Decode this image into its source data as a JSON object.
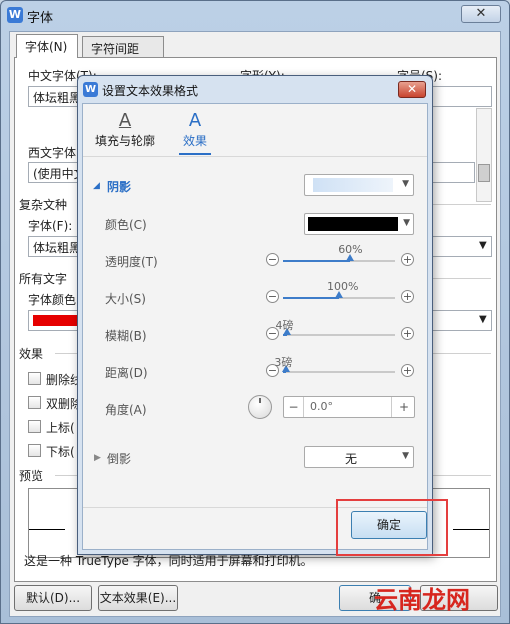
{
  "window": {
    "title": "字体",
    "app_icon_glyph": "W",
    "close_glyph": "✕"
  },
  "tabs": [
    {
      "label": "字体(N)",
      "active": true
    },
    {
      "label": "字符间距(R)",
      "active": false
    }
  ],
  "font_section": {
    "chinese_font_label": "中文字体(T):",
    "chinese_font_value": "体坛粗黑",
    "style_label": "字形(Y):",
    "size_label": "字号(S):",
    "western_font_label": "西文字体(",
    "western_font_value": "(使用中文",
    "complex_group_label": "复杂文种",
    "complex_font_label": "字体(F):",
    "complex_font_value": "体坛粗黑",
    "all_text_group_label": "所有文字",
    "font_color_label": "字体颜色(",
    "font_color_value": "#e60000",
    "effects_group_label": "效果",
    "effects": [
      "删除线",
      "双删除",
      "上标(",
      "下标("
    ],
    "preview_group_label": "预览",
    "truetype_note": "这是一种 TrueType 字体，同时适用于屏幕和打印机。"
  },
  "footer_buttons": {
    "default": "默认(D)...",
    "text_effect": "文本效果(E)...",
    "ok_partial": "确",
    "cancel_partial": ""
  },
  "dialog": {
    "title": "设置文本效果格式",
    "icon_glyph": "W",
    "close_glyph": "✕",
    "tabs": [
      {
        "label": "填充与轮廓",
        "glyph": "A",
        "active": false
      },
      {
        "label": "效果",
        "glyph": "A",
        "active": true
      }
    ],
    "shadow": {
      "label": "阴影",
      "color_label": "颜色(C)",
      "color_value": "#000000",
      "sliders": [
        {
          "label": "透明度(T)",
          "value": "60%",
          "fraction": 0.6
        },
        {
          "label": "大小(S)",
          "value": "100%",
          "fraction": 0.5
        },
        {
          "label": "模糊(B)",
          "value": "4磅",
          "fraction": 0.04
        },
        {
          "label": "距离(D)",
          "value": "3磅",
          "fraction": 0.03
        }
      ],
      "angle_label": "角度(A)",
      "angle_value": "0.0°",
      "minus_glyph": "−",
      "plus_glyph": "+"
    },
    "reflection": {
      "label": "倒影",
      "value": "无"
    },
    "ok_button": "确定"
  },
  "watermark": "云南龙网",
  "colors": {
    "accent": "#2b6fc6",
    "highlight_red": "#e43e3e"
  }
}
